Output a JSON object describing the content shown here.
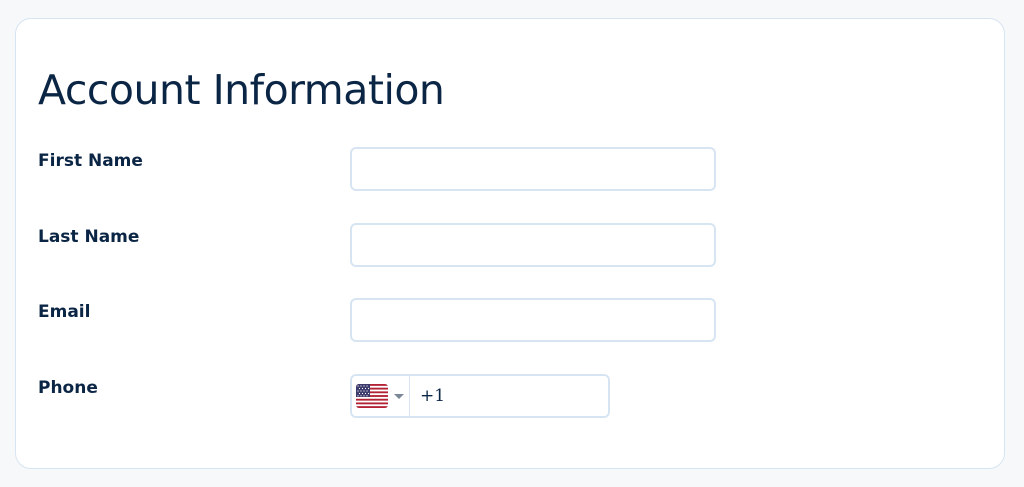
{
  "form": {
    "title": "Account Information",
    "fields": [
      {
        "label": "First Name",
        "value": ""
      },
      {
        "label": "Last Name",
        "value": ""
      },
      {
        "label": "Email",
        "value": ""
      }
    ],
    "phone": {
      "label": "Phone",
      "country_flag_icon": "us-flag-icon",
      "dial_code": "+1"
    }
  },
  "colors": {
    "text": "#0b2545",
    "border": "#d7e5f3",
    "page_background": "#f6f8fa",
    "card_background": "#ffffff"
  }
}
